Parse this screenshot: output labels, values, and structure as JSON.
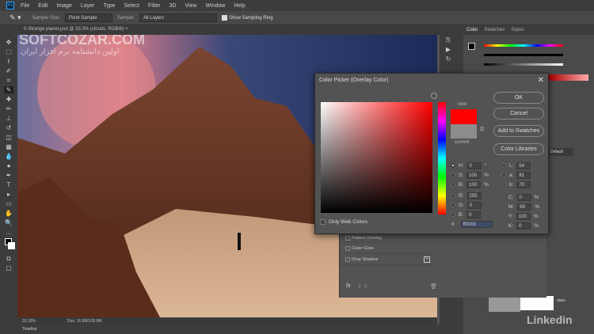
{
  "app": {
    "logo": "Ps"
  },
  "menu": [
    "File",
    "Edit",
    "Image",
    "Layer",
    "Type",
    "Select",
    "Filter",
    "3D",
    "View",
    "Window",
    "Help"
  ],
  "options": {
    "sample_size_label": "Sample Size:",
    "sample_size_value": "Point Sample",
    "sample_label": "Sample:",
    "sample_value": "All Layers",
    "show_ring_label": "Show Sampling Ring",
    "show_ring_checked": true
  },
  "document": {
    "tab_title": "0-Strange planet.psd @ 33.3% (clouds, RGB/8) ×",
    "zoom": "33.33%",
    "doc_size": "Doc: 16.6M/109.8M"
  },
  "timeline_label": "Timeline",
  "watermark": {
    "text": "SOFTCOZAR.COM",
    "subtitle": "اولین دانشنامه نرم افزار ایران"
  },
  "color_panel": {
    "tabs": [
      "Color",
      "Swatches",
      "Styles"
    ],
    "sliders": [
      "H",
      "S",
      "B"
    ]
  },
  "color_picker": {
    "title": "Color Picker (Overlay Color)",
    "ok": "OK",
    "cancel": "Cancel",
    "add_to_swatches": "Add to Swatches",
    "color_libraries": "Color Libraries",
    "new_label": "new",
    "current_label": "current",
    "new_color": "#ff0000",
    "current_color": "#8c8c8c",
    "only_web_colors": "Only Web Colors",
    "hsb": [
      {
        "label": "H:",
        "value": "0",
        "unit": "°",
        "selected": true
      },
      {
        "label": "S:",
        "value": "100",
        "unit": "%"
      },
      {
        "label": "B:",
        "value": "100",
        "unit": "%"
      }
    ],
    "rgb": [
      {
        "label": "R:",
        "value": "255"
      },
      {
        "label": "G:",
        "value": "0"
      },
      {
        "label": "B:",
        "value": "0"
      }
    ],
    "lab": [
      {
        "label": "L:",
        "value": "54"
      },
      {
        "label": "a:",
        "value": "81"
      },
      {
        "label": "b:",
        "value": "70"
      }
    ],
    "cmyk": [
      {
        "label": "C:",
        "value": "0",
        "unit": "%"
      },
      {
        "label": "M:",
        "value": "99",
        "unit": "%"
      },
      {
        "label": "Y:",
        "value": "100",
        "unit": "%"
      },
      {
        "label": "K:",
        "value": "0",
        "unit": "%"
      }
    ],
    "hex_label": "#",
    "hex": "ff0000"
  },
  "layer_style": {
    "items": [
      "Pattern Overlay",
      "Outer Glow",
      "Drop Shadow"
    ],
    "fx": "fx"
  },
  "right_panel": {
    "default_btn": "Default",
    "layer_name": "stars"
  },
  "brand": "Linkedin"
}
